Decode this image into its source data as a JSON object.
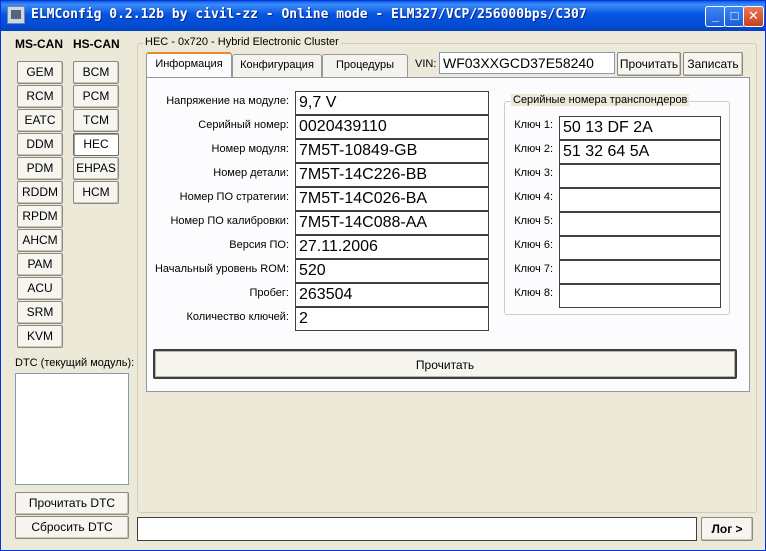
{
  "window": {
    "title": "ELMConfig 0.2.12b by civil-zz - Online mode - ELM327/VCP/256000bps/C307",
    "minimize": "_",
    "maximize": "□",
    "close": "✕"
  },
  "sidebar": {
    "ms_can_label": "MS-CAN",
    "hs_can_label": "HS-CAN",
    "ms_modules": [
      "GEM",
      "RCM",
      "EATC",
      "DDM",
      "PDM",
      "RDDM",
      "RPDM",
      "AHCM",
      "PAM",
      "ACU",
      "SRM",
      "KVM"
    ],
    "hs_modules": [
      "BCM",
      "PCM",
      "TCM",
      "HEC",
      "EHPAS",
      "HCM"
    ],
    "selected_module": "HEC",
    "dtc_label": "DTC (текущий модуль):",
    "read_dtc": "Прочитать DTC",
    "clear_dtc": "Сбросить DTC"
  },
  "module_panel": {
    "title": "HEC - 0x720 - Hybrid Electronic Cluster",
    "tabs": [
      "Информация",
      "Конфигурация",
      "Процедуры"
    ],
    "active_tab": "Информация",
    "vin_label": "VIN:",
    "vin_value": "WF03XXGCD37E58240",
    "read_button": "Прочитать",
    "write_button": "Записать"
  },
  "info": {
    "rows": [
      {
        "label": "Напряжение на модуле:",
        "value": "9,7 V"
      },
      {
        "label": "Серийный номер:",
        "value": "0020439110"
      },
      {
        "label": "Номер модуля:",
        "value": "7M5T-10849-GB"
      },
      {
        "label": "Номер детали:",
        "value": "7M5T-14C226-BB"
      },
      {
        "label": "Номер ПО стратегии:",
        "value": "7M5T-14C026-BA"
      },
      {
        "label": "Номер ПО калибровки:",
        "value": "7M5T-14C088-AA"
      },
      {
        "label": "Версия ПО:",
        "value": "27.11.2006"
      },
      {
        "label": "Начальный уровень ROM:",
        "value": "520"
      },
      {
        "label": "Пробег:",
        "value": "263504"
      },
      {
        "label": "Количество ключей:",
        "value": "2"
      }
    ],
    "transponders_title": "Серийные номера транспондеров",
    "keys": [
      {
        "label": "Ключ 1:",
        "value": "50 13 DF 2A"
      },
      {
        "label": "Ключ 2:",
        "value": "51 32 64 5A"
      },
      {
        "label": "Ключ 3:",
        "value": ""
      },
      {
        "label": "Ключ 4:",
        "value": ""
      },
      {
        "label": "Ключ 5:",
        "value": ""
      },
      {
        "label": "Ключ 6:",
        "value": ""
      },
      {
        "label": "Ключ 7:",
        "value": ""
      },
      {
        "label": "Ключ 8:",
        "value": ""
      }
    ],
    "read_button": "Прочитать"
  },
  "statusbar": {
    "log_value": "",
    "log_button": "Лог >"
  }
}
